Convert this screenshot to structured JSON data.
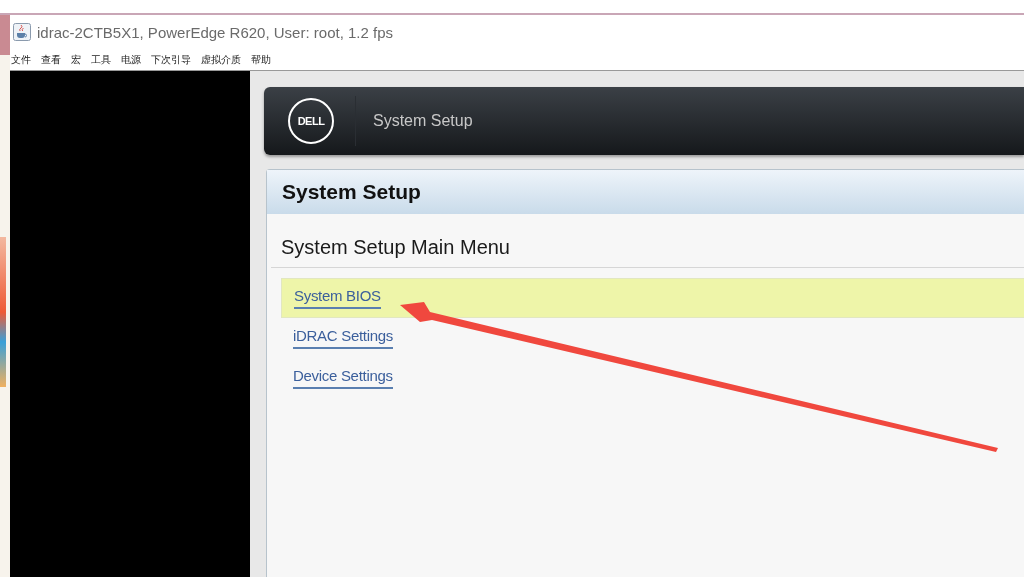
{
  "window": {
    "title": "idrac-2CTB5X1, PowerEdge R620, User: root, 1.2 fps"
  },
  "menu": [
    "文件",
    "查看",
    "宏",
    "工具",
    "电源",
    "下次引导",
    "虚拟介质",
    "帮助"
  ],
  "header": {
    "logo": "DELL",
    "title": "System Setup"
  },
  "panel": {
    "title": "System Setup",
    "heading": "System Setup Main Menu",
    "items": [
      {
        "label": "System BIOS",
        "selected": true
      },
      {
        "label": "iDRAC Settings",
        "selected": false
      },
      {
        "label": "Device Settings",
        "selected": false
      }
    ]
  }
}
